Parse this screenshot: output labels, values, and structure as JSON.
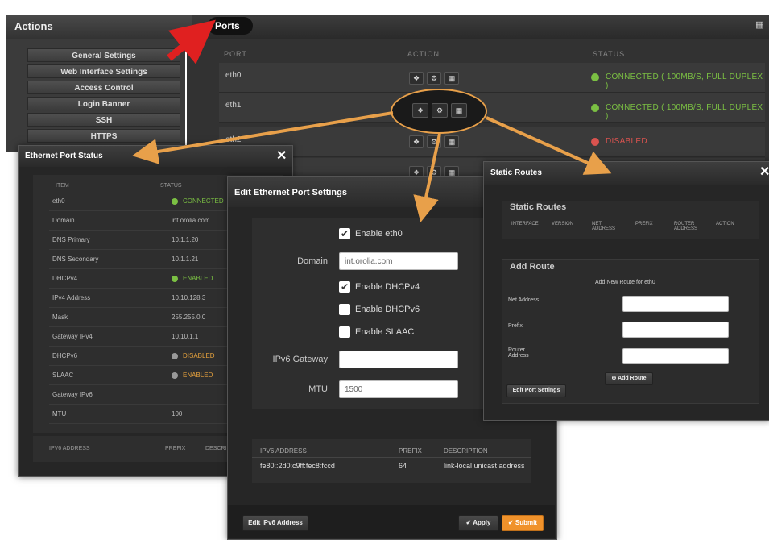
{
  "topbar": {
    "actions_title": "Actions",
    "ports_tab": "Ports",
    "grid_icon": "grid-icon"
  },
  "sidebar": {
    "items": [
      "General Settings",
      "Web Interface Settings",
      "Access Control",
      "Login Banner",
      "SSH",
      "HTTPS"
    ]
  },
  "ports": {
    "headers": {
      "port": "PORT",
      "action": "ACTION",
      "status": "STATUS"
    },
    "rows": [
      {
        "name": "eth0",
        "status": "CONNECTED ( 100MB/S, FULL DUPLEX )",
        "status_color": "#7bc043"
      },
      {
        "name": "eth1",
        "status": "CONNECTED ( 100MB/S, FULL DUPLEX )",
        "status_color": "#7bc043"
      },
      {
        "name": "eth2",
        "status": "DISABLED",
        "status_color": "#d9534f"
      },
      {
        "name": "",
        "status": "",
        "status_color": ""
      }
    ],
    "action_icons": [
      "info-icon",
      "gear-icon",
      "grid-icon"
    ]
  },
  "eth_status": {
    "title": "Ethernet Port Status",
    "col_item": "ITEM",
    "col_status": "STATUS",
    "rows": [
      {
        "k": "eth0",
        "v": "CONNECTED",
        "dot": "#7bc043",
        "vcolor": "#7bc043"
      },
      {
        "k": "Domain",
        "v": "int.orolia.com",
        "dot": "",
        "vcolor": "#bbb"
      },
      {
        "k": "DNS Primary",
        "v": "10.1.1.20",
        "dot": "",
        "vcolor": "#bbb"
      },
      {
        "k": "DNS Secondary",
        "v": "10.1.1.21",
        "dot": "",
        "vcolor": "#bbb"
      },
      {
        "k": "DHCPv4",
        "v": "ENABLED",
        "dot": "#7bc043",
        "vcolor": "#7bc043"
      },
      {
        "k": "IPv4 Address",
        "v": "10.10.128.3",
        "dot": "",
        "vcolor": "#bbb"
      },
      {
        "k": "Mask",
        "v": "255.255.0.0",
        "dot": "",
        "vcolor": "#bbb"
      },
      {
        "k": "Gateway IPv4",
        "v": "10.10.1.1",
        "dot": "",
        "vcolor": "#bbb"
      },
      {
        "k": "DHCPv6",
        "v": "DISABLED",
        "dot": "#999",
        "vcolor": "#e8a33d"
      },
      {
        "k": "SLAAC",
        "v": "ENABLED",
        "dot": "#999",
        "vcolor": "#e8a33d"
      },
      {
        "k": "Gateway IPv6",
        "v": "",
        "dot": "",
        "vcolor": "#bbb"
      },
      {
        "k": "MTU",
        "v": "100",
        "dot": "",
        "vcolor": "#bbb"
      }
    ],
    "ipv6_headers": [
      "IPV6 ADDRESS",
      "PREFIX",
      "DESCRIPTI"
    ]
  },
  "edit_eth": {
    "title": "Edit Ethernet Port Settings",
    "enable_eth0": "Enable eth0",
    "domain_label": "Domain",
    "domain_value": "int.orolia.com",
    "enable_dhcpv4": "Enable DHCPv4",
    "enable_dhcpv6": "Enable DHCPv6",
    "enable_slaac": "Enable SLAAC",
    "ipv6_gateway_label": "IPv6 Gateway",
    "ipv6_gateway_value": "",
    "mtu_label": "MTU",
    "mtu_value": "1500",
    "checks": {
      "eth0": true,
      "dhcpv4": true,
      "dhcpv6": false,
      "slaac": false
    },
    "ipv6_table": {
      "headers": [
        "IPV6 ADDRESS",
        "PREFIX",
        "DESCRIPTION"
      ],
      "row": [
        "fe80::2d0:c9ff:fec8:fccd",
        "64",
        "link-local unicast address"
      ]
    },
    "edit_ipv6_btn": "Edit IPv6 Address",
    "apply_btn": "✔ Apply",
    "submit_btn": "✔ Submit",
    "submit_color": "#f0922b"
  },
  "static_routes": {
    "title": "Static Routes",
    "section_title": "Static Routes",
    "headers": [
      "INTERFACE",
      "VERSION",
      "NET ADDRESS",
      "PREFIX",
      "ROUTER ADDRESS",
      "ACTION"
    ],
    "add_route_title": "Add Route",
    "add_new_label": "Add New Route for eth0",
    "net_address_label": "Net Address",
    "prefix_label": "Prefix",
    "router_address_label": "Router Address",
    "add_route_btn": "⊕ Add Route",
    "edit_port_settings_btn": "Edit Port Settings"
  },
  "annotation": {
    "arrow_color": "#e8a04a",
    "red_arrow_color": "#e02020"
  }
}
